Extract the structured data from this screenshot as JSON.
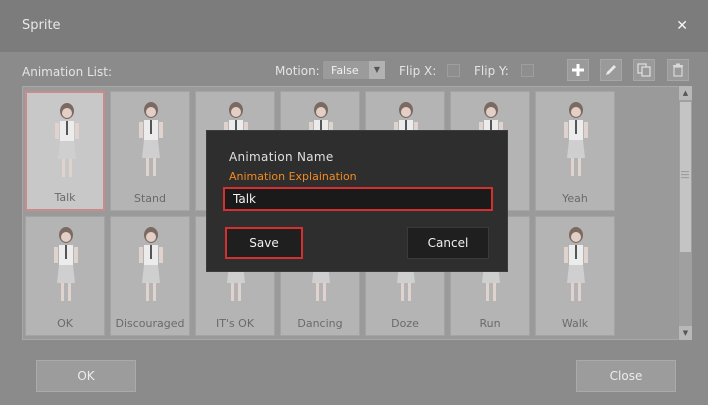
{
  "window": {
    "title": "Sprite"
  },
  "toolbar": {
    "animation_list_label": "Animation List:",
    "motion_label": "Motion:",
    "motion_value": "False",
    "flip_x_label": "Flip X:",
    "flip_y_label": "Flip Y:",
    "flip_x_checked": false,
    "flip_y_checked": false,
    "buttons": [
      "plus-icon",
      "pencil-icon",
      "copy-icon",
      "trash-icon"
    ]
  },
  "animations": [
    {
      "label": "Talk",
      "selected": true
    },
    {
      "label": "Stand",
      "selected": false
    },
    {
      "label": "",
      "selected": false
    },
    {
      "label": "",
      "selected": false
    },
    {
      "label": "",
      "selected": false
    },
    {
      "label": "ed",
      "selected": false
    },
    {
      "label": "Yeah",
      "selected": false
    },
    {
      "label": "OK",
      "selected": false
    },
    {
      "label": "Discouraged",
      "selected": false
    },
    {
      "label": "IT's OK",
      "selected": false
    },
    {
      "label": "Dancing",
      "selected": false
    },
    {
      "label": "Doze",
      "selected": false
    },
    {
      "label": "Run",
      "selected": false
    },
    {
      "label": "Walk",
      "selected": false
    }
  ],
  "footer": {
    "ok_label": "OK",
    "close_label": "Close"
  },
  "dialog": {
    "title": "Animation Name",
    "subtitle": "Animation Explaination",
    "input_value": "Talk",
    "save_label": "Save",
    "cancel_label": "Cancel"
  },
  "colors": {
    "accent_orange": "#f08a24",
    "highlight_red": "#d43030",
    "dialog_bg": "#2e2e2e"
  }
}
